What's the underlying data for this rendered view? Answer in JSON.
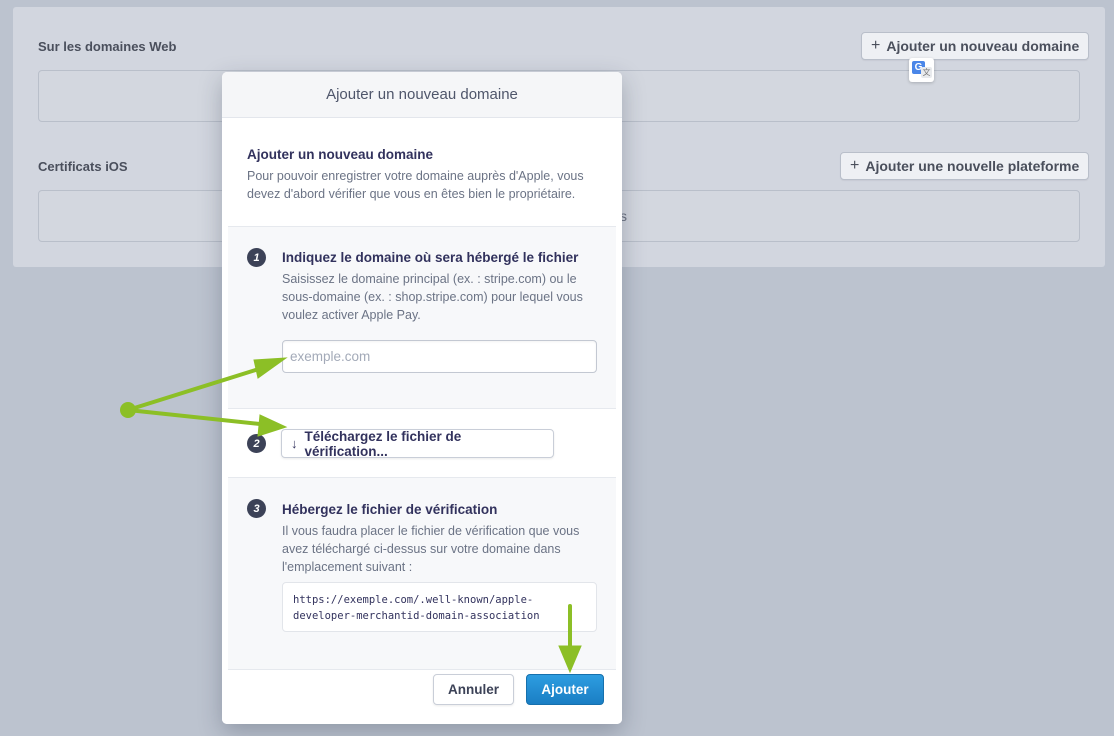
{
  "background": {
    "web_domains_title": "Sur les domaines Web",
    "add_domain_button": "Ajouter un nouveau domaine",
    "ios_certs_title": "Certificats iOS",
    "add_platform_button": "Ajouter une nouvelle plateforme",
    "ghost_text": "s"
  },
  "translate_icon": {
    "g": "G",
    "a": "文"
  },
  "modal": {
    "title": "Ajouter un nouveau domaine",
    "intro_title": "Ajouter un nouveau domaine",
    "intro_text": "Pour pouvoir enregistrer votre domaine auprès d'Apple, vous devez d'abord vérifier que vous en êtes bien le propriétaire.",
    "steps": [
      {
        "number": "1",
        "title": "Indiquez le domaine où sera hébergé le fichier",
        "text": "Saisissez le domaine principal (ex. : stripe.com) ou le sous-domaine (ex. : shop.stripe.com) pour lequel vous voulez activer Apple Pay.",
        "input_placeholder": "exemple.com",
        "input_value": ""
      },
      {
        "number": "2",
        "button_label": "Téléchargez le fichier de vérification..."
      },
      {
        "number": "3",
        "title": "Hébergez le fichier de vérification",
        "text": "Il vous faudra placer le fichier de vérification que vous avez téléchargé ci-dessus sur votre domaine dans l'emplacement suivant :",
        "url": "https://exemple.com/.well-known/apple-developer-merchantid-domain-association"
      }
    ],
    "cancel_label": "Annuler",
    "add_label": "Ajouter"
  },
  "colors": {
    "primary": "#1a7ec4",
    "annotation": "#8cbf26",
    "step_badge": "#3c4257"
  },
  "icons": {
    "plus": "plus-icon",
    "download": "arrow-down-icon",
    "translate": "google-translate-icon"
  }
}
